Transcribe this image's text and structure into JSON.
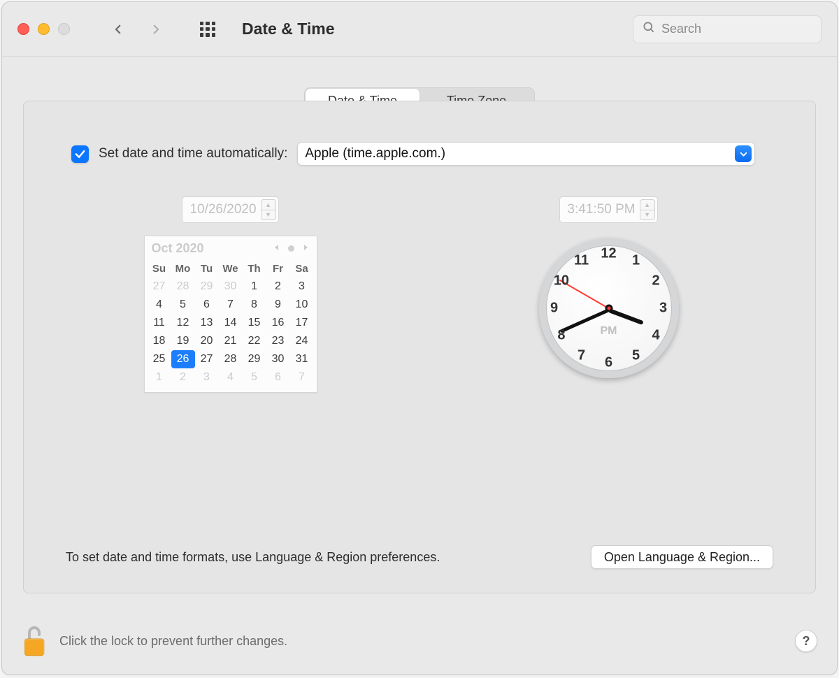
{
  "window": {
    "title": "Date & Time",
    "search_placeholder": "Search"
  },
  "tabs": {
    "date_time": "Date & Time",
    "time_zone": "Time Zone",
    "active": "date_time"
  },
  "auto": {
    "checked": true,
    "label": "Set date and time automatically:",
    "server": "Apple (time.apple.com.)"
  },
  "date": {
    "field": "10/26/2020",
    "month_label": "Oct 2020",
    "dow": [
      "Su",
      "Mo",
      "Tu",
      "We",
      "Th",
      "Fr",
      "Sa"
    ],
    "weeks": [
      [
        {
          "d": 27,
          "out": true
        },
        {
          "d": 28,
          "out": true
        },
        {
          "d": 29,
          "out": true
        },
        {
          "d": 30,
          "out": true
        },
        {
          "d": 1
        },
        {
          "d": 2
        },
        {
          "d": 3
        }
      ],
      [
        {
          "d": 4
        },
        {
          "d": 5
        },
        {
          "d": 6
        },
        {
          "d": 7
        },
        {
          "d": 8
        },
        {
          "d": 9
        },
        {
          "d": 10
        }
      ],
      [
        {
          "d": 11
        },
        {
          "d": 12
        },
        {
          "d": 13
        },
        {
          "d": 14
        },
        {
          "d": 15
        },
        {
          "d": 16
        },
        {
          "d": 17
        }
      ],
      [
        {
          "d": 18
        },
        {
          "d": 19
        },
        {
          "d": 20
        },
        {
          "d": 21
        },
        {
          "d": 22
        },
        {
          "d": 23
        },
        {
          "d": 24
        }
      ],
      [
        {
          "d": 25
        },
        {
          "d": 26,
          "sel": true
        },
        {
          "d": 27
        },
        {
          "d": 28
        },
        {
          "d": 29
        },
        {
          "d": 30
        },
        {
          "d": 31
        }
      ],
      [
        {
          "d": 1,
          "out": true
        },
        {
          "d": 2,
          "out": true
        },
        {
          "d": 3,
          "out": true
        },
        {
          "d": 4,
          "out": true
        },
        {
          "d": 5,
          "out": true
        },
        {
          "d": 6,
          "out": true
        },
        {
          "d": 7,
          "out": true
        }
      ]
    ]
  },
  "time": {
    "field": "3:41:50 PM",
    "period": "PM",
    "hour": 3,
    "minute": 41,
    "second": 50,
    "numerals": [
      "12",
      "1",
      "2",
      "3",
      "4",
      "5",
      "6",
      "7",
      "8",
      "9",
      "10",
      "11"
    ]
  },
  "footer": {
    "hint": "To set date and time formats, use Language & Region preferences.",
    "open_button": "Open Language & Region..."
  },
  "lock": {
    "message": "Click the lock to prevent further changes.",
    "locked": false
  },
  "help_label": "?"
}
